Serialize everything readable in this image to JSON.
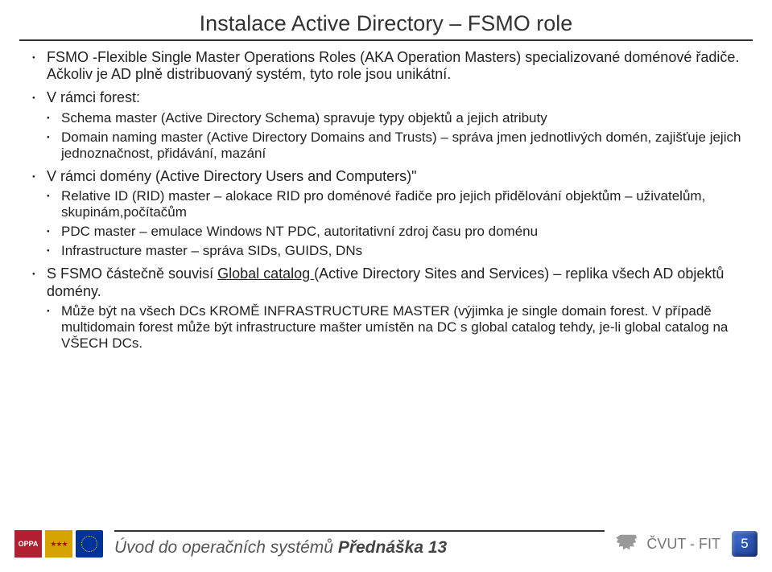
{
  "title": "Instalace Active Directory – FSMO role",
  "bullets": {
    "b1": "FSMO -Flexible Single Master Operations Roles (AKA Operation Masters) specializované doménové řadiče. Ačkoliv je AD plně distribuovaný systém, tyto role jsou unikátní.",
    "b2": "V rámci forest:",
    "b2a": "Schema master (Active Directory Schema) spravuje typy objektů a jejich atributy",
    "b2b": "Domain naming master (Active Directory Domains and Trusts) – správa jmen jednotlivých domén, zajišťuje jejich jednoznačnost, přidávání, mazání",
    "b3": "V rámci domény (Active Directory Users and Computers)\"",
    "b3a": "Relative ID (RID) master – alokace RID pro doménové řadiče pro jejich přidělování objektům – uživatelům, skupinám,počítačům",
    "b3b": "PDC master – emulace Windows NT PDC, autoritativní zdroj času pro doménu",
    "b3c": "Infrastructure master – správa SIDs, GUIDS, DNs",
    "b4_pre": "S FSMO částečně souvisí ",
    "b4_u": "Global catalog ",
    "b4_post": "(Active Directory Sites and Services) – replika všech AD objektů domény.",
    "b4a": "Může být na všech DCs KROMĚ INFRASTRUCTURE MASTER (výjimka je single domain forest. V případě multidomain forest může být infrastructure mašter umístěn na DC s global catalog tehdy, je-li global catalog na VŠECH DCs."
  },
  "footer": {
    "subtitle_plain": "Úvod do operačních systémů  ",
    "subtitle_bold": "Přednáška 13",
    "org": "ČVUT - FIT",
    "page": "5"
  }
}
